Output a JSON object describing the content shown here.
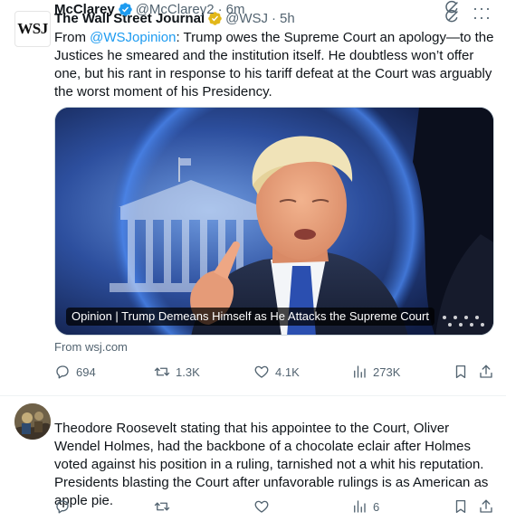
{
  "post1": {
    "avatar_text": "WSJ",
    "name": "The Wall Street Journal",
    "handle": "@WSJ",
    "time": "5h",
    "text_prefix": "From ",
    "mention": "@WSJopinion",
    "text_body": ": Trump owes the Supreme Court an apology—to the Justices he smeared and the institution itself. He doubtless won’t offer one, but his rant in response to his tariff defeat at the Court was arguably the worst moment of his Presidency.",
    "card_label": "Opinion | Trump Demeans Himself as He Attacks the Supreme Court",
    "source": "From wsj.com",
    "replies": "694",
    "reposts": "1.3K",
    "likes": "4.1K",
    "views": "273K"
  },
  "post2": {
    "name": "McClarey",
    "handle": "@McClarey2",
    "time": "6m",
    "text": "Theodore Roosevelt stating that his appointee to the Court, Oliver Wendel Holmes, had the backbone of a chocolate eclair after Holmes voted against his position in a ruling, tarnished not a whit his reputation.  Presidents blasting the Court after unfavorable rulings is as American as apple pie.",
    "views": "6"
  },
  "colors": {
    "accent": "#1d9bf0",
    "secondary_text": "#536471",
    "verified_gold": "#e2b719",
    "verified_blue": "#1d9bf0"
  },
  "icons": [
    "grok-icon",
    "more-icon",
    "reply-icon",
    "repost-icon",
    "like-icon",
    "views-icon",
    "bookmark-icon",
    "share-icon"
  ]
}
